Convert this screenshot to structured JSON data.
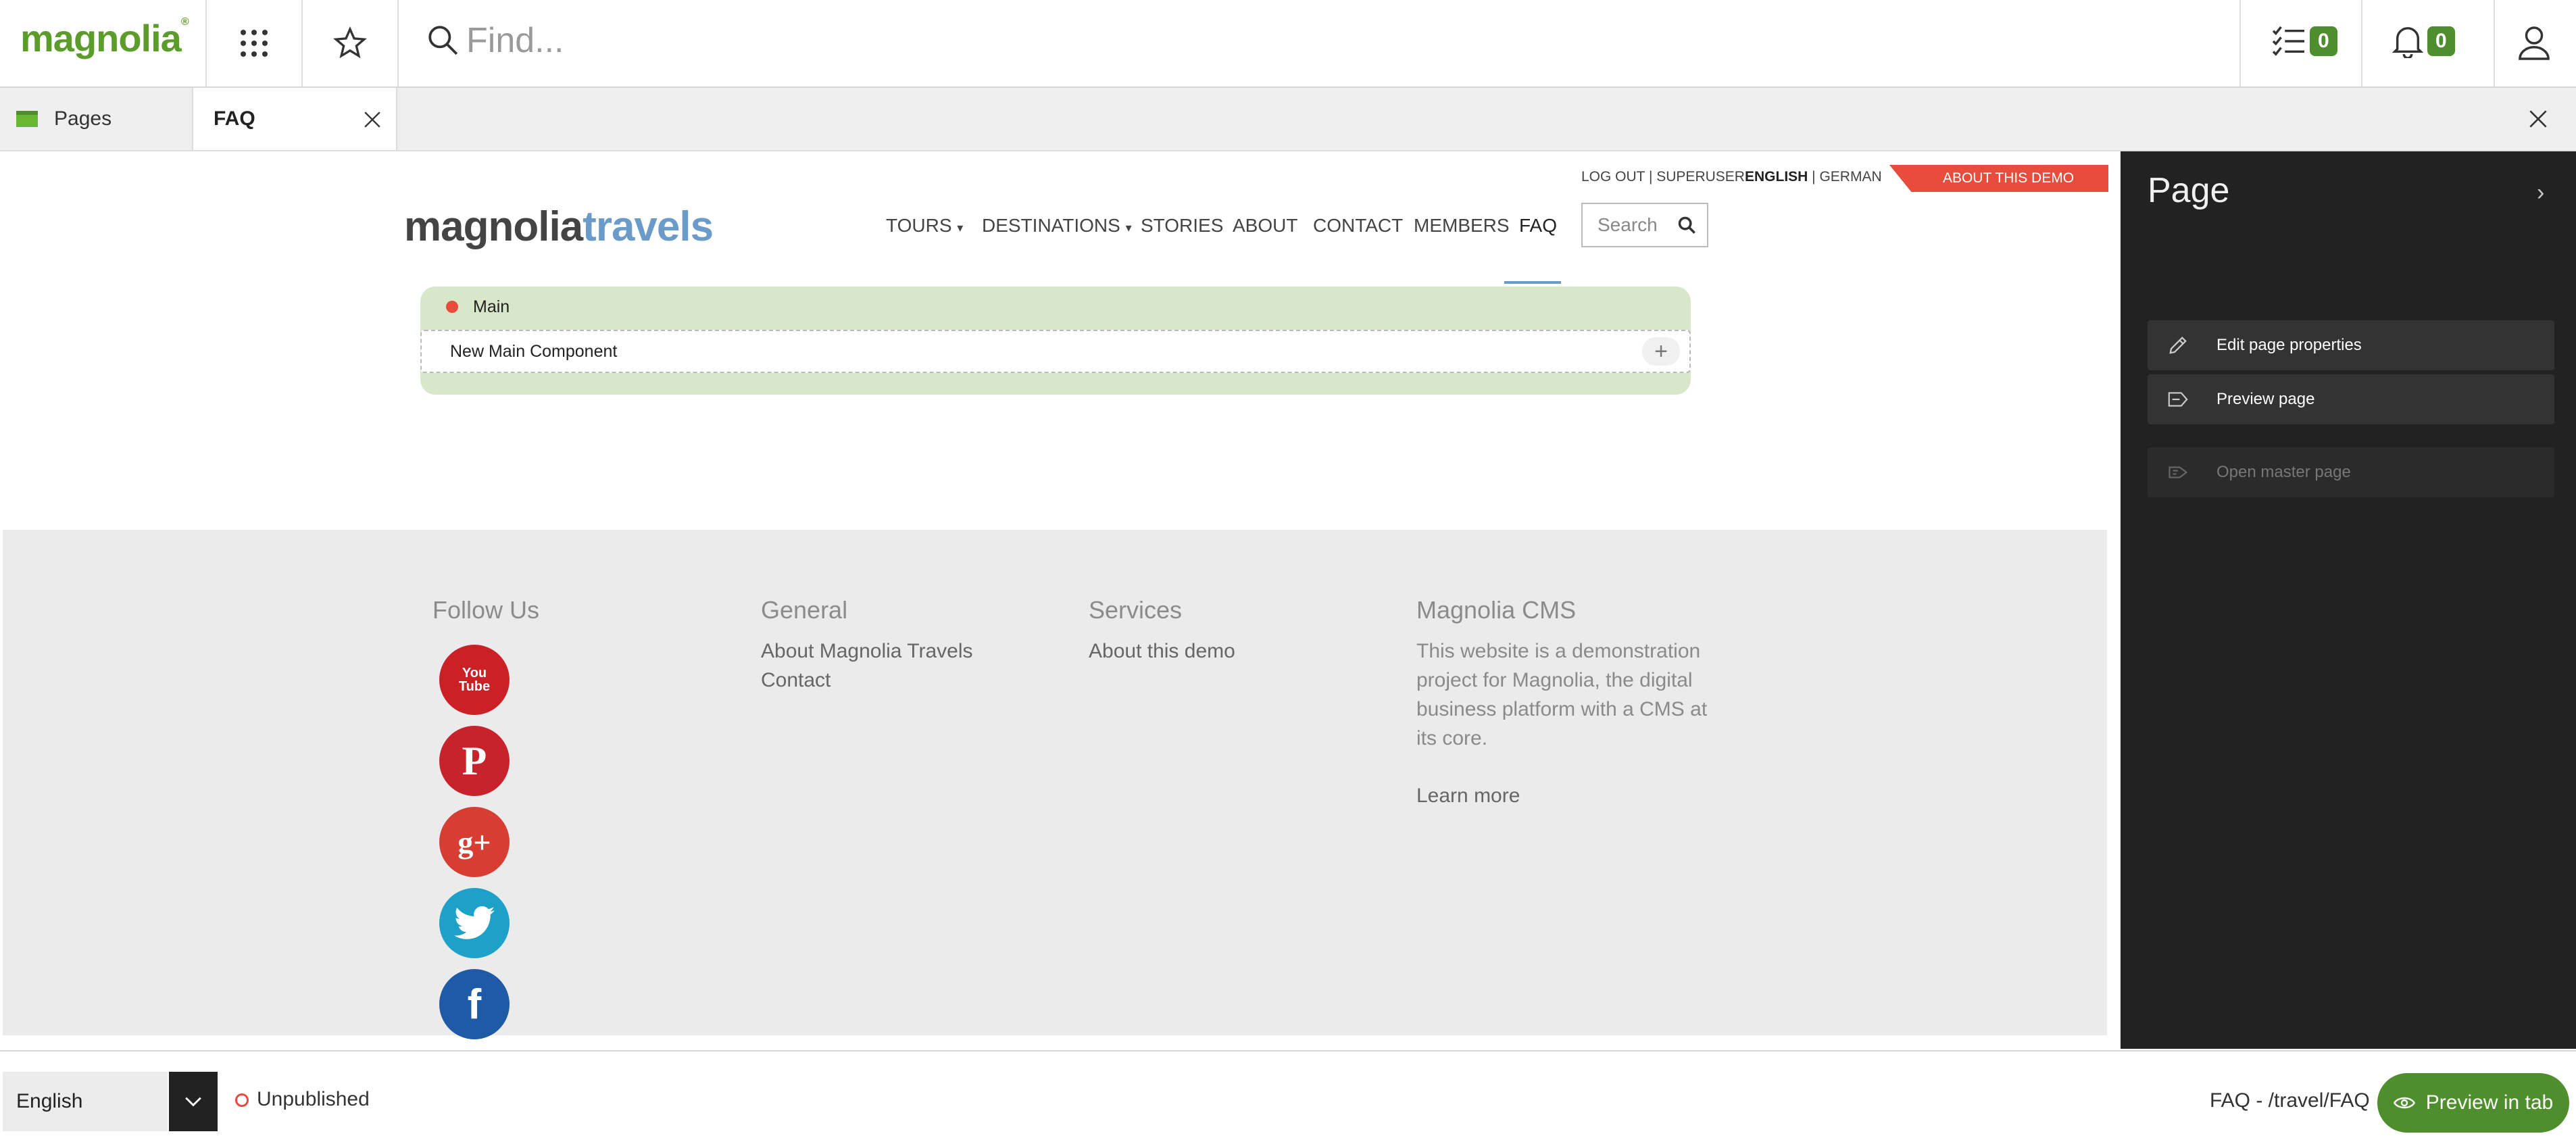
{
  "app": {
    "logo": "magnolia",
    "search_placeholder": "Find...",
    "tasks_count": "0",
    "notifications_count": "0"
  },
  "tabs": [
    {
      "label": "Pages"
    },
    {
      "label": "FAQ"
    }
  ],
  "page": {
    "header": {
      "logout": "LOG OUT | SUPERUSER",
      "lang_current": "ENGLISH",
      "lang_sep": " | ",
      "lang_other": "GERMAN",
      "about_demo": "ABOUT THIS DEMO"
    },
    "brand": {
      "part1": "magnolia",
      "part2": "travels"
    },
    "nav": [
      "TOURS",
      "DESTINATIONS",
      "STORIES",
      "ABOUT",
      "CONTACT",
      "MEMBERS",
      "FAQ"
    ],
    "site_search_placeholder": "Search",
    "area": {
      "name": "Main",
      "component": "New Main Component"
    },
    "footer": {
      "follow": "Follow Us",
      "general": {
        "title": "General",
        "links": [
          "About Magnolia Travels",
          "Contact"
        ]
      },
      "services": {
        "title": "Services",
        "links": [
          "About this demo"
        ]
      },
      "cms": {
        "title": "Magnolia CMS",
        "text": [
          "This website is a demonstration",
          "project for Magnolia, the digital",
          "business platform with a CMS at",
          "its core."
        ],
        "learn_more": "Learn more"
      },
      "social": [
        "YouTube",
        "Pinterest",
        "Google+",
        "Twitter",
        "Facebook"
      ]
    }
  },
  "panel": {
    "title": "Page",
    "actions": [
      "Edit page properties",
      "Preview page",
      "Open master page"
    ]
  },
  "bottom": {
    "language": "English",
    "status": "Unpublished",
    "path": "FAQ - /travel/FAQ",
    "preview_button": "Preview in tab"
  },
  "colors": {
    "brand_green": "#5c9c2a",
    "accent_red": "#e74c3c",
    "area_green": "#d8e6c9",
    "panel_bg": "#222222"
  }
}
